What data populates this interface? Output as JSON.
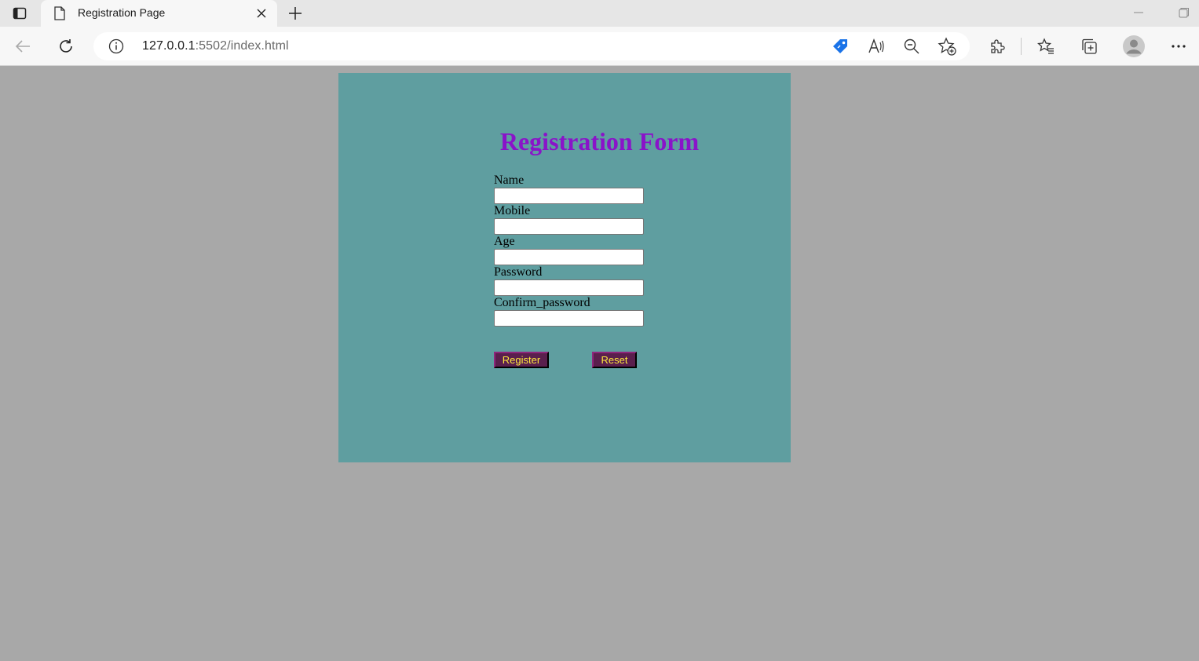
{
  "browser": {
    "tab_title": "Registration Page",
    "url_host": "127.0.0.1",
    "url_rest": ":5502/index.html"
  },
  "form": {
    "title": "Registration Form",
    "fields": [
      {
        "label": "Name",
        "value": ""
      },
      {
        "label": "Mobile",
        "value": ""
      },
      {
        "label": "Age",
        "value": ""
      },
      {
        "label": "Password",
        "value": ""
      },
      {
        "label": "Confirm_password",
        "value": ""
      }
    ],
    "register_label": "Register",
    "reset_label": "Reset"
  },
  "colors": {
    "page_background": "#a8a8a8",
    "card_background": "#5f9ea0",
    "title_color": "#8a13c9",
    "button_background": "#5a1f4d",
    "button_text": "#ffeb3b"
  },
  "icons": {
    "tab_actions": "tab-actions-icon",
    "page": "page-icon",
    "close": "close-icon",
    "new_tab": "plus-icon",
    "back": "back-arrow-icon",
    "refresh": "refresh-icon",
    "info": "info-icon",
    "shopping": "tag-icon",
    "read_aloud": "read-aloud-icon",
    "zoom_out": "zoom-out-icon",
    "add_favorite": "add-favorite-icon",
    "extensions": "puzzle-icon",
    "favorites": "favorites-icon",
    "collections": "collections-icon",
    "profile": "profile-avatar-icon",
    "more": "more-dots-icon"
  }
}
